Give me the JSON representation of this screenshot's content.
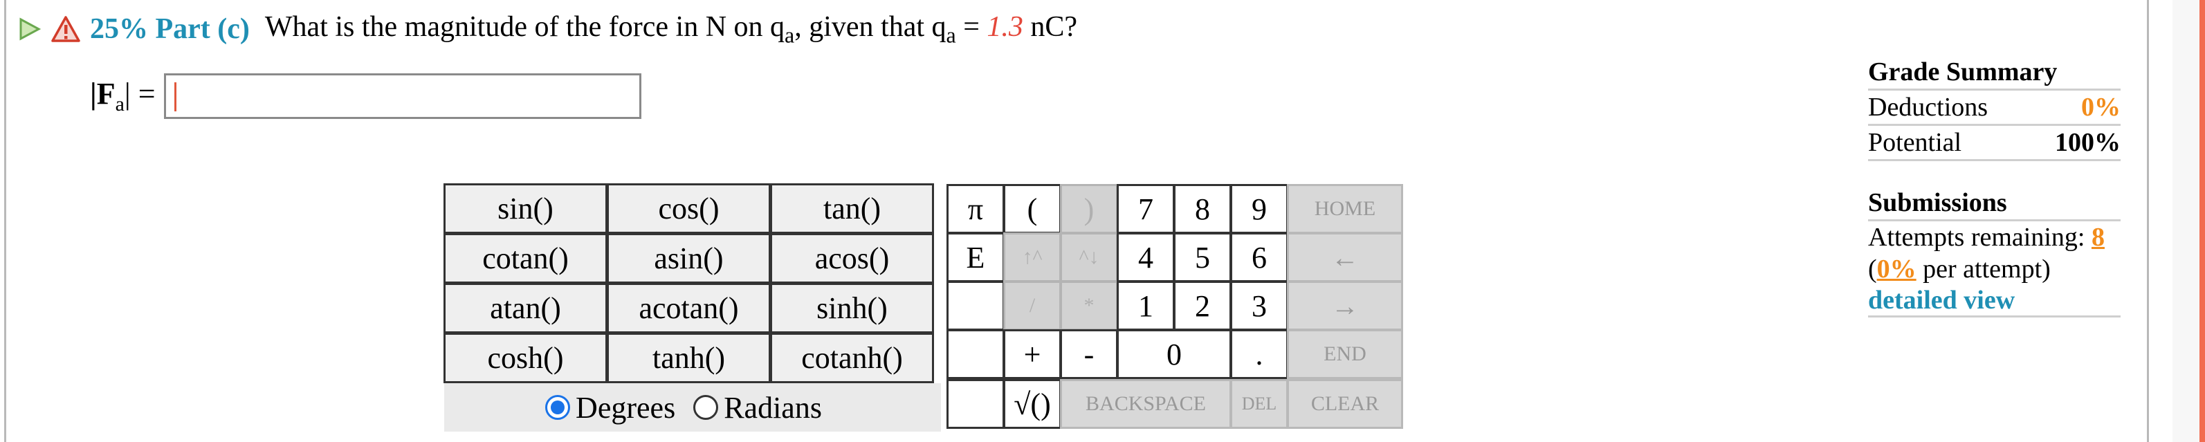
{
  "header": {
    "percent_part": "25% Part (c)",
    "question_prefix": "What is the magnitude of the force in N on q",
    "question_sub1": "a",
    "question_mid": ", given that q",
    "question_sub2": "a",
    "question_equals": " = ",
    "question_value": "1.3",
    "question_unit": " nC?"
  },
  "answer": {
    "label_main": "|F",
    "label_sub": "a",
    "label_tail": "| =",
    "input_value": ""
  },
  "functions": [
    "sin()",
    "cos()",
    "tan()",
    "cotan()",
    "asin()",
    "acos()",
    "atan()",
    "acotan()",
    "sinh()",
    "cosh()",
    "tanh()",
    "cotanh()"
  ],
  "angle_mode": {
    "degrees_label": "Degrees",
    "radians_label": "Radians",
    "selected": "Degrees"
  },
  "keys": {
    "pi": "π",
    "e": "E",
    "lparen": "(",
    "rparen": ")",
    "up": "↑^",
    "down": "^↓",
    "div": "/",
    "mul": "*",
    "plus": "+",
    "minus": "-",
    "sqrt": "√()",
    "n7": "7",
    "n8": "8",
    "n9": "9",
    "n4": "4",
    "n5": "5",
    "n6": "6",
    "n1": "1",
    "n2": "2",
    "n3": "3",
    "n0": "0",
    "dot": ".",
    "home": "HOME",
    "left": "←",
    "right": "→",
    "end": "END",
    "backspace": "BACKSPACE",
    "del": "DEL",
    "clear": "CLEAR"
  },
  "grade_summary": {
    "title": "Grade Summary",
    "deductions_label": "Deductions",
    "deductions_value": "0%",
    "potential_label": "Potential",
    "potential_value": "100%"
  },
  "submissions": {
    "title": "Submissions",
    "attempts_label": "Attempts remaining: ",
    "attempts_value": "8",
    "per_open": "(",
    "per_value": "0%",
    "per_tail": " per attempt)",
    "detail_link": "detailed view"
  },
  "colors": {
    "part_label": "#1f8fb4",
    "value_red": "#e4473a",
    "orange": "#f28c1b",
    "radio_blue": "#1a73e8"
  }
}
